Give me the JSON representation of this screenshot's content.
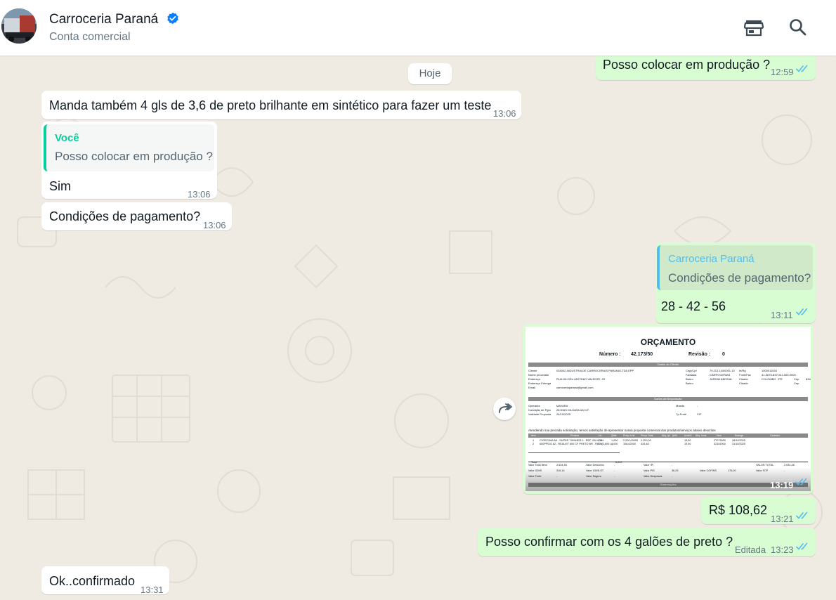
{
  "header": {
    "contact_name": "Carroceria Paraná",
    "subtitle": "Conta comercial",
    "icons": [
      "storefront-icon",
      "search-icon",
      "verified-badge-icon"
    ]
  },
  "colors": {
    "incoming_bubble": "#ffffff",
    "outgoing_bubble": "#d9fdd3",
    "read_ticks": "#53bdeb",
    "quote_accent_in": "#06cf9c",
    "quote_accent_out": "#53bdeb",
    "wallpaper": "#efeae2"
  },
  "day_chip": "Hoje",
  "messages": [
    {
      "dir": "out",
      "text": "Posso colocar em produção ?",
      "time": "12:59",
      "status": "read"
    },
    {
      "dir": "in",
      "text": "Manda também 4 gls de 3,6 de preto brilhante em sintético para fazer um teste",
      "time": "13:06"
    },
    {
      "dir": "in",
      "quote_author": "Você",
      "quote_text": "Posso colocar em produção ?",
      "text": "Sim",
      "time": "13:06"
    },
    {
      "dir": "in",
      "text": "Condições de pagamento?",
      "time": "13:06"
    },
    {
      "dir": "out",
      "quote_author": "Carroceria Paraná",
      "quote_text": "Condições de pagamento?",
      "text": "28 - 42 - 56",
      "time": "13:11",
      "status": "read"
    },
    {
      "dir": "out",
      "type": "image",
      "time": "13:19",
      "status": "read"
    },
    {
      "dir": "out",
      "text": "R$ 108,62",
      "time": "13:21",
      "status": "read"
    },
    {
      "dir": "out",
      "text": "Posso confirmar com os 4 galões de preto ?",
      "edited_label": "Editada",
      "time": "13:23",
      "status": "read"
    },
    {
      "dir": "in",
      "text": "Ok..confirmado",
      "time": "13:31"
    }
  ],
  "document": {
    "title": "ORÇAMENTO",
    "numero_label": "Número :",
    "numero_value": "42.173/50",
    "revisao_label": "Revisão :",
    "revisao_value": "0",
    "city_date": "COLOMBO , 24 de OUTUBRO de 2025",
    "section_cliente": "Dados do Cliente",
    "section_negociacao": "Dados da Negociação",
    "section_obs": "Observações",
    "cliente_rows": [
      [
        "Cliente",
        "034002-INDUSTRIA DE CARROCERIAS PARANA LTDA EPP",
        "Cnpj/Cpf",
        "79.213.143/0001-10",
        "Ie/Rg",
        "1000011534"
      ],
      [
        "Nome p/Contato",
        "",
        "Fantasia",
        "CARROCERIAS",
        "Fone/Fax",
        "41-3675-8371/41-000-0000"
      ],
      [
        "Endereço",
        "RUA DILOEU ANTONIO VALENTE, 25",
        "Bairro",
        "JARDIM ABISSAL",
        "Cidade",
        "COLOMBO",
        "/PR",
        "Cep",
        "83409-750"
      ],
      [
        "Endereço Entrega",
        "",
        "Bairro",
        "",
        "Cidade",
        "",
        "",
        "Cep",
        ""
      ],
      [
        "Email",
        "carroceriaparana@gmail.com"
      ]
    ],
    "negociacao_rows": [
      [
        "Operador",
        "MAYARA",
        "Moeda",
        "-"
      ],
      [
        "Condição de Pgto",
        "28 DIAS DA DATA DA N.F.",
        "",
        ""
      ],
      [
        "Validade Proposta",
        "24/10/2025",
        "Tp.Frete",
        "CIF"
      ]
    ],
    "intro_text": "Atendendo sua prezada solicitação, temos satisfação de apresentar nossa proposta comercial dos produtos/serviços abaixo descritos",
    "items_header": [
      "Item",
      "Produto",
      "Un",
      "Qtde",
      "Preço Unit",
      "Preço Total",
      "Alíq. Ipi",
      "Ipi%",
      "Icms%",
      "Alíq. Icms",
      "Ncm",
      "Entrega",
      "Cadastro"
    ],
    "items": [
      [
        "1",
        "CV2ECD66.66 - SUPER THINNER II - REF. 200.000 L",
        "UN",
        "1,000",
        "2.200,00000",
        "2.200,00",
        "",
        "",
        "19,50",
        "",
        "27079090",
        "28/10/2025",
        ""
      ],
      [
        "2",
        "600PP002.62 - REALVIT 600 CF PRETO BR - REF. (3,600 L)",
        "UN",
        "4,000",
        "108,62000",
        "434,48",
        "",
        "",
        "19,50",
        "",
        "32151900",
        "31/10/2025",
        ""
      ]
    ],
    "total_label": "Total",
    "total_qty": "5,000",
    "totals_rows": [
      [
        "Valor Total Itens",
        "2.634,48",
        "Valor Desconto",
        "-",
        "Valor IPI",
        "-",
        "",
        "",
        "VALOR TOTAL",
        "2.634,48"
      ],
      [
        "Valor ICMS",
        "316,14",
        "Valor ICMS-ST",
        "-",
        "Valor PIS",
        "36,25",
        "Valor COFINS",
        "176,20",
        "Valor FCP",
        "-"
      ],
      [
        "Valor Frete",
        "-",
        "Valor Seguro",
        "-",
        "Valor Despesas",
        "-",
        "",
        "",
        "",
        ""
      ]
    ]
  }
}
